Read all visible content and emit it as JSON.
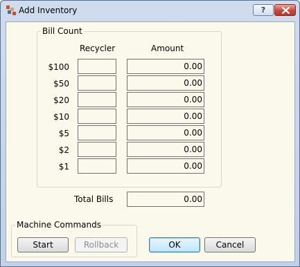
{
  "window": {
    "title": "Add Inventory"
  },
  "titlebar": {
    "help_label": "?"
  },
  "bill_count": {
    "legend": "Bill Count",
    "col_recycler": "Recycler",
    "col_amount": "Amount",
    "rows": [
      {
        "denom": "$100",
        "recycler": "",
        "amount": "0.00"
      },
      {
        "denom": "$50",
        "recycler": "",
        "amount": "0.00"
      },
      {
        "denom": "$20",
        "recycler": "",
        "amount": "0.00"
      },
      {
        "denom": "$10",
        "recycler": "",
        "amount": "0.00"
      },
      {
        "denom": "$5",
        "recycler": "",
        "amount": "0.00"
      },
      {
        "denom": "$2",
        "recycler": "",
        "amount": "0.00"
      },
      {
        "denom": "$1",
        "recycler": "",
        "amount": "0.00"
      }
    ]
  },
  "total": {
    "label": "Total Bills",
    "value": "0.00"
  },
  "machine_commands": {
    "legend": "Machine Commands",
    "start_label": "Start",
    "rollback_label": "Rollback"
  },
  "dialog": {
    "ok_label": "OK",
    "cancel_label": "Cancel"
  }
}
